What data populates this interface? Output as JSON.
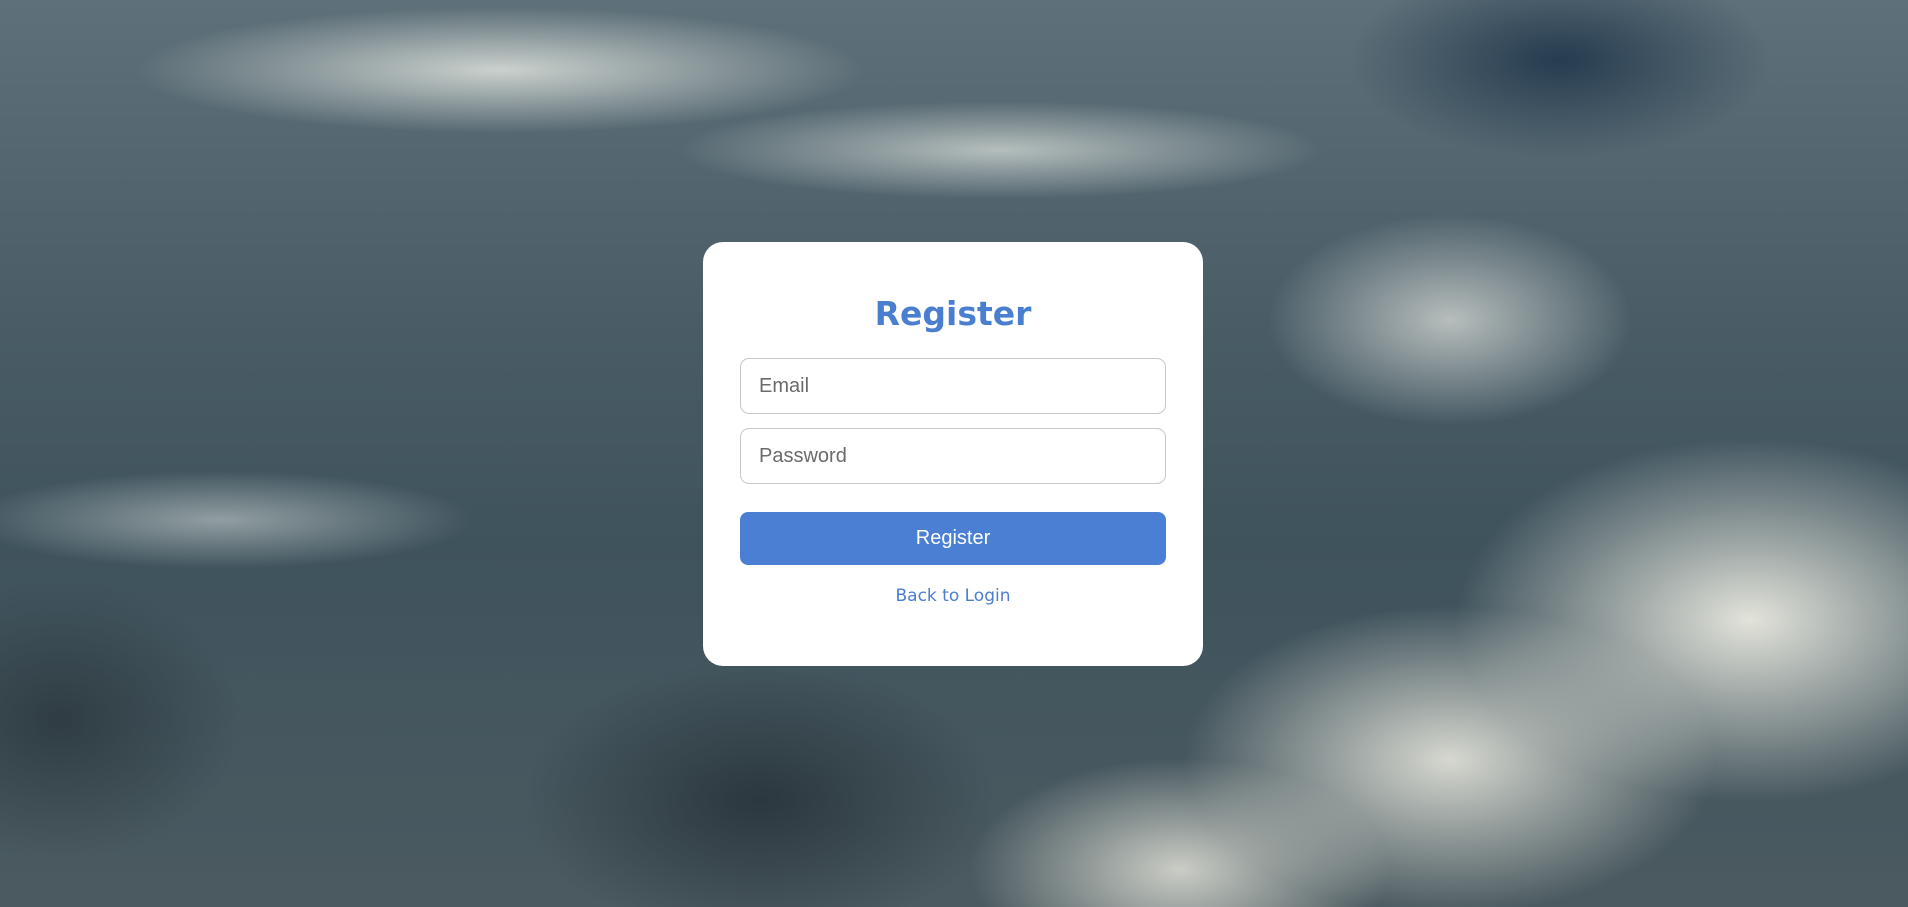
{
  "form": {
    "title": "Register",
    "email_placeholder": "Email",
    "password_placeholder": "Password",
    "submit_label": "Register",
    "back_link_label": "Back to Login"
  },
  "colors": {
    "accent": "#4a7fd4",
    "card_background": "#ffffff"
  }
}
